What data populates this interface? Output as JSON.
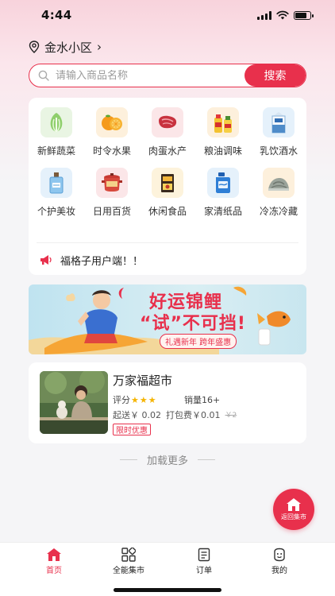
{
  "status_bar": {
    "time": "4:44"
  },
  "location": {
    "name": "金水小区"
  },
  "search": {
    "placeholder": "请输入商品名称",
    "button_label": "搜索"
  },
  "categories": [
    {
      "label": "新鲜蔬菜",
      "icon": "vegetable-icon",
      "bg": "#e9f5e3"
    },
    {
      "label": "时令水果",
      "icon": "orange-icon",
      "bg": "#fdf0dc"
    },
    {
      "label": "肉蛋水产",
      "icon": "meat-icon",
      "bg": "#fbe6e8"
    },
    {
      "label": "粮油调味",
      "icon": "oil-bottle-icon",
      "bg": "#fdf0dc"
    },
    {
      "label": "乳饮酒水",
      "icon": "milk-carton-icon",
      "bg": "#e5f1fb"
    },
    {
      "label": "个护美妆",
      "icon": "perfume-icon",
      "bg": "#e5f1fb"
    },
    {
      "label": "日用百货",
      "icon": "pot-icon",
      "bg": "#fbe6e8"
    },
    {
      "label": "休闲食品",
      "icon": "snack-box-icon",
      "bg": "#fdf3dc"
    },
    {
      "label": "家清纸品",
      "icon": "detergent-icon",
      "bg": "#e5f1fb"
    },
    {
      "label": "冷冻冷藏",
      "icon": "frozen-food-icon",
      "bg": "#fdf0dc"
    }
  ],
  "notice": {
    "text": "福格子用户端！！"
  },
  "banner": {
    "title": "好运锦鲤",
    "subtitle": "“试”不可挡!",
    "tag": "礼遇新年 跨年盛惠"
  },
  "shop": {
    "name": "万家福超市",
    "rating_label": "评分",
    "stars": 3,
    "sales": "销量16+",
    "min_order": "起送￥ 0.02",
    "packing_fee": "打包费￥0.01",
    "original_price": "￥2",
    "badge": "限时优惠"
  },
  "load_more": "加载更多",
  "float_button": {
    "label": "返回集市"
  },
  "tabs": [
    {
      "label": "首页",
      "icon": "home-icon",
      "active": true
    },
    {
      "label": "全能集市",
      "icon": "grid-icon",
      "active": false
    },
    {
      "label": "订单",
      "icon": "order-icon",
      "active": false
    },
    {
      "label": "我的",
      "icon": "profile-icon",
      "active": false
    }
  ],
  "colors": {
    "accent": "#e8304c",
    "star": "#f5b400"
  }
}
